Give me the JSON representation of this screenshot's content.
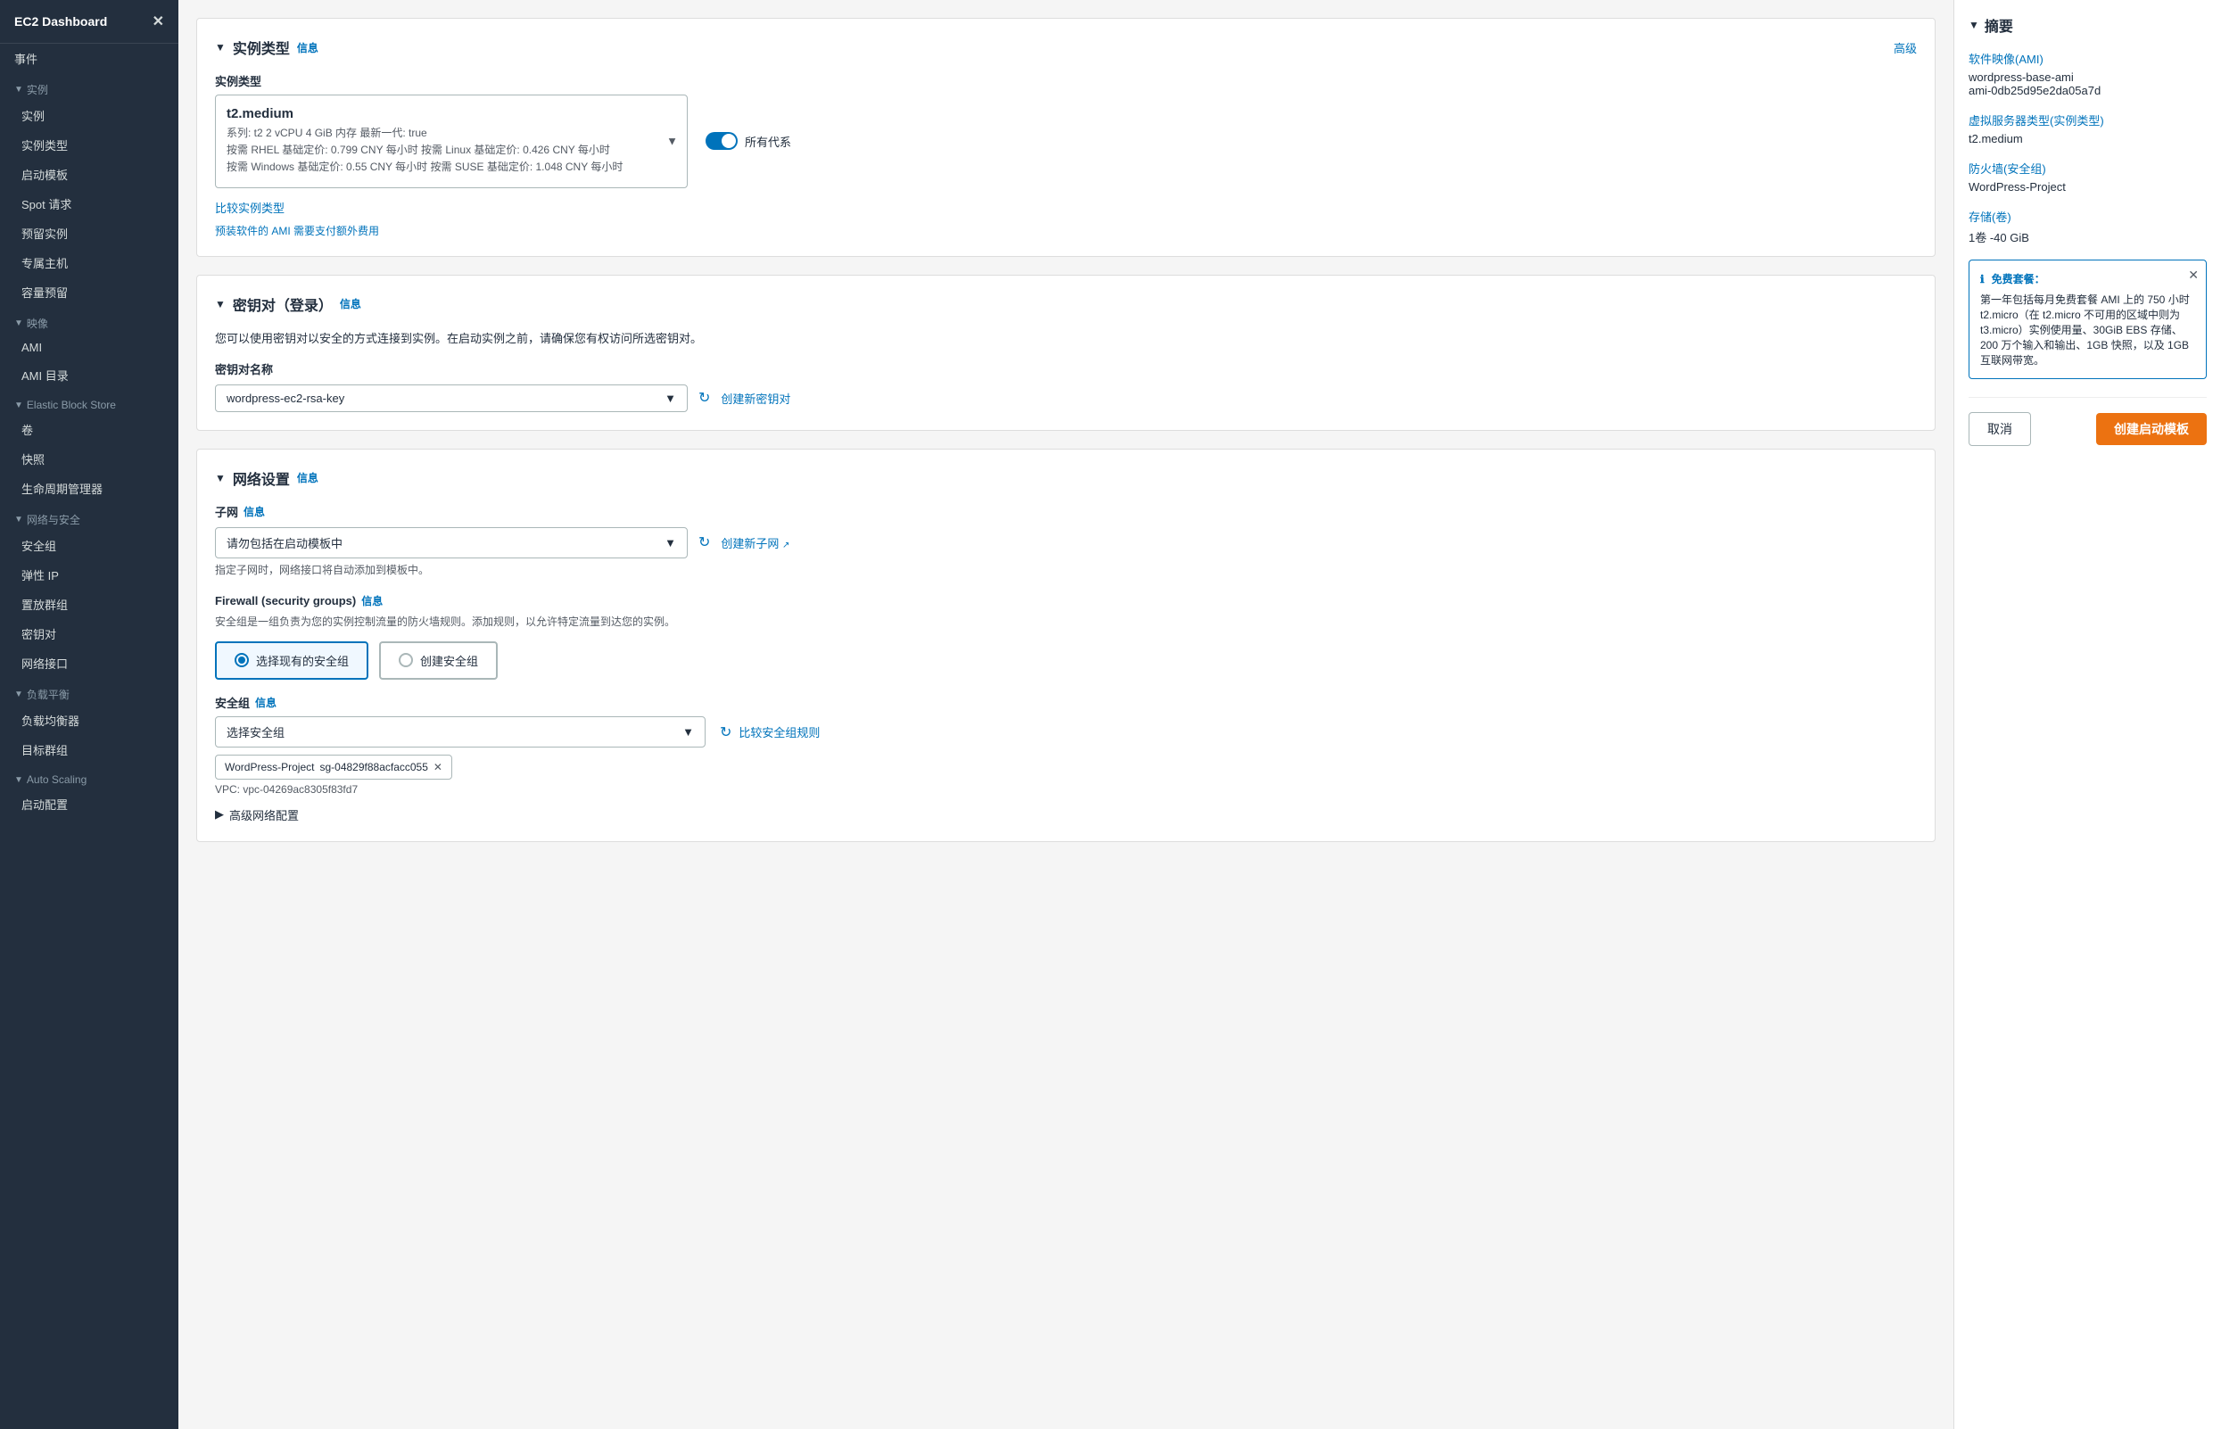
{
  "sidebar": {
    "header": "EC2 Dashboard",
    "close_icon": "✕",
    "sections": [
      {
        "label": "事件",
        "type": "item"
      },
      {
        "label": "实例",
        "type": "section",
        "items": [
          "实例",
          "实例类型",
          "启动模板",
          "Spot 请求",
          "预留实例",
          "专属主机",
          "容量预留"
        ]
      },
      {
        "label": "映像",
        "type": "section",
        "items": [
          "AMI",
          "AMI 目录"
        ]
      },
      {
        "label": "Elastic Block Store",
        "type": "section",
        "items": [
          "卷",
          "快照",
          "生命周期管理器"
        ]
      },
      {
        "label": "网络与安全",
        "type": "section",
        "items": [
          "安全组",
          "弹性 IP",
          "置放群组",
          "密钥对",
          "网络接口"
        ]
      },
      {
        "label": "负载平衡",
        "type": "section",
        "items": [
          "负载均衡器",
          "目标群组"
        ]
      },
      {
        "label": "Auto Scaling",
        "type": "section",
        "items": [
          "启动配置"
        ]
      }
    ]
  },
  "instance_type_section": {
    "title": "实例类型",
    "info_label": "信息",
    "advanced_label": "高级",
    "subsection_label": "实例类型",
    "instance_name": "t2.medium",
    "instance_details_line1": "系列: t2    2 vCPU    4 GiB 内存    最新一代: true",
    "instance_details_line2": "按需 RHEL 基础定价: 0.799 CNY 每小时    按需 Linux 基础定价: 0.426 CNY 每小时",
    "instance_details_line3": "按需 Windows 基础定价: 0.55 CNY 每小时    按需 SUSE 基础定价: 1.048 CNY 每小时",
    "family_filter_label": "所有代系",
    "compare_label": "比较实例类型",
    "ami_note": "预装软件的 AMI 需要支付额外费用"
  },
  "keypair_section": {
    "title": "密钥对（登录）",
    "info_label": "信息",
    "description": "您可以使用密钥对以安全的方式连接到实例。在启动实例之前，请确保您有权访问所选密钥对。",
    "field_label": "密钥对名称",
    "selected_key": "wordpress-ec2-rsa-key",
    "create_label": "创建新密钥对"
  },
  "network_section": {
    "title": "网络设置",
    "info_label": "信息",
    "subnet_label": "子网",
    "subnet_info_label": "信息",
    "subnet_placeholder": "请勿包括在启动模板中",
    "subnet_note": "指定子网时，网络接口将自动添加到模板中。",
    "create_subnet_label": "创建新子网",
    "firewall_label": "Firewall (security groups)",
    "firewall_info_label": "信息",
    "firewall_desc": "安全组是一组负责为您的实例控制流量的防火墙规则。添加规则，以允许特定流量到达您的实例。",
    "radio_option1": "选择现有的安全组",
    "radio_option2": "创建安全组",
    "sg_label": "安全组",
    "sg_info_label": "信息",
    "sg_placeholder": "选择安全组",
    "sg_tag_name": "WordPress-Project",
    "sg_tag_id": "sg-04829f88acfacc055",
    "sg_tag_vpc": "VPC: vpc-04269ac8305f83fd7",
    "compare_sg_label": "比较安全组规则",
    "advanced_net_label": "高级网络配置"
  },
  "summary": {
    "title": "摘要",
    "ami_label": "软件映像(AMI)",
    "ami_value": "wordpress-base-ami",
    "ami_id": "ami-0db25d95e2da05a7d",
    "instance_type_label": "虚拟服务器类型(实例类型)",
    "instance_type_value": "t2.medium",
    "firewall_label": "防火墙(安全组)",
    "firewall_value": "WordPress-Project",
    "storage_label": "存储(卷)",
    "storage_value": "1卷 -40 GiB",
    "free_tier_title": "免费套餐：",
    "free_tier_body": "第一年包括每月免费套餐 AMI 上的 750 小时 t2.micro（在 t2.micro 不可用的区域中则为 t3.micro）实例使用量、30GiB EBS 存储、200 万个输入和输出、1GB 快照，以及 1GB 互联网带宽。",
    "cancel_label": "取消",
    "create_label": "创建启动模板"
  }
}
